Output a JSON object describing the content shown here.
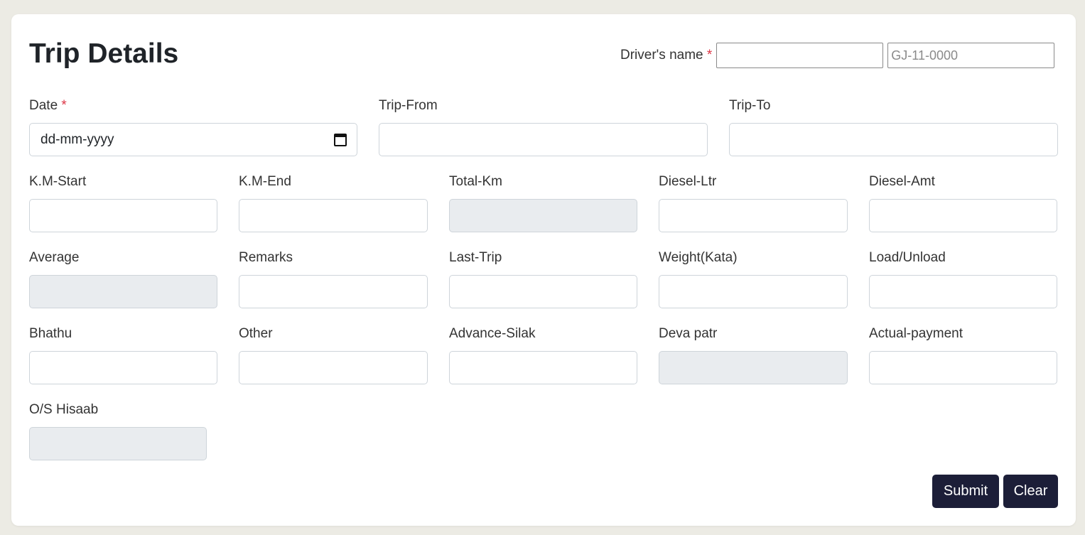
{
  "form": {
    "title": "Trip Details",
    "required_mark": "*",
    "driver": {
      "label": "Driver's name",
      "name_value": "",
      "plate_placeholder": "GJ-11-0000"
    },
    "date": {
      "label": "Date",
      "value": "dd-mm-yyyy"
    },
    "fields": {
      "trip_from": "Trip-From",
      "trip_to": "Trip-To",
      "km_start": "K.M-Start",
      "km_end": "K.M-End",
      "total_km": "Total-Km",
      "diesel_ltr": "Diesel-Ltr",
      "diesel_amt": "Diesel-Amt",
      "average": "Average",
      "remarks": "Remarks",
      "last_trip": "Last-Trip",
      "weight": "Weight(Kata)",
      "load_unload": "Load/Unload",
      "bhathu": "Bhathu",
      "other": "Other",
      "advance_silak": "Advance-Silak",
      "deva_patr": "Deva patr",
      "actual_payment": "Actual-payment",
      "os_hisaab": "O/S Hisaab"
    },
    "buttons": {
      "submit": "Submit",
      "clear": "Clear"
    },
    "icons": {
      "date_picker": "calendar-icon"
    },
    "colors": {
      "button_bg": "#1c1e38",
      "readonly_bg": "#e9ecef",
      "required": "#dc3545",
      "page_bg": "#ecebe4"
    }
  }
}
